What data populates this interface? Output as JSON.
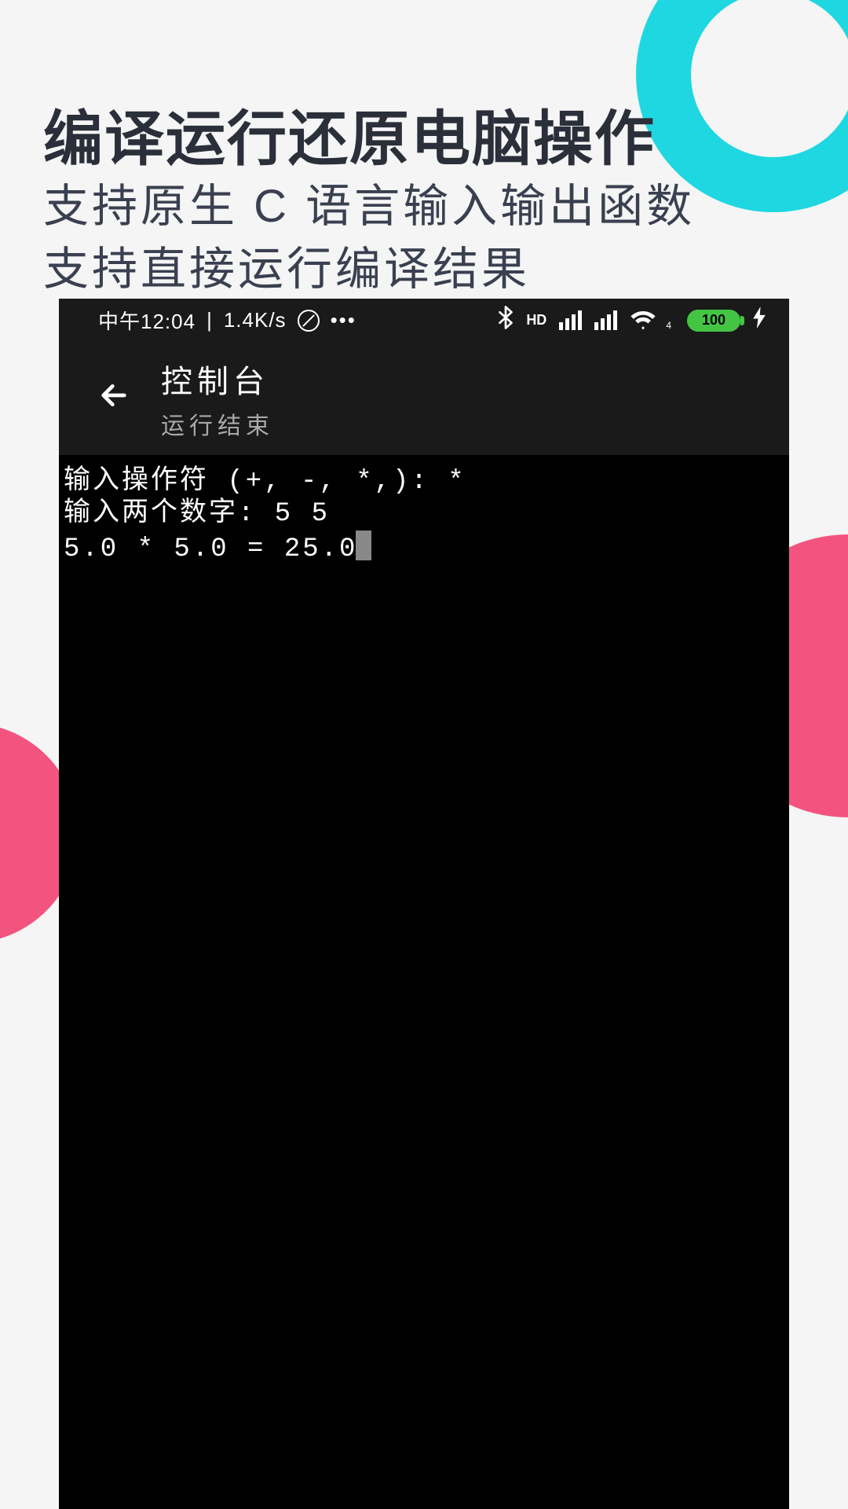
{
  "promo": {
    "heading": "编译运行还原电脑操作",
    "subheading1": "支持原生 C 语言输入输出函数",
    "subheading2": "支持直接运行编译结果"
  },
  "status": {
    "time": "中午12:04",
    "speed": "1.4K/s",
    "dots": "•••",
    "hd": "HD",
    "wifi_sub": "4",
    "battery": "100"
  },
  "appbar": {
    "title": "控制台",
    "subtitle": "运行结束"
  },
  "console": {
    "line1": "输入操作符 (+, -, *,): *",
    "line2": "输入两个数字: 5 5",
    "line3": "5.0 * 5.0 = 25.0"
  }
}
